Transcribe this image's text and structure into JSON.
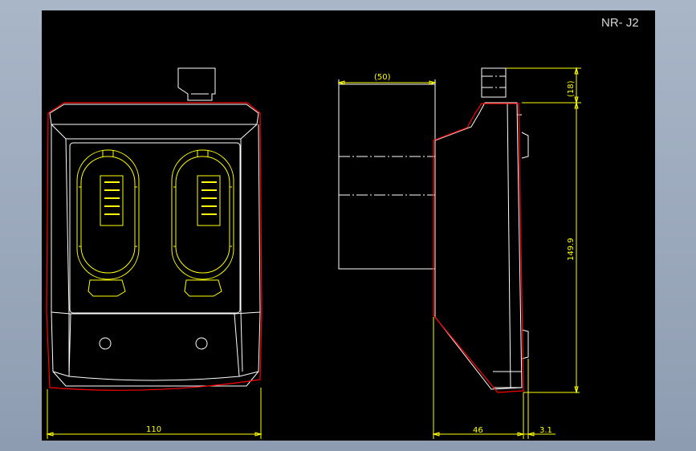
{
  "drawing": {
    "title": "NR- J2",
    "dimensions": {
      "width": "110",
      "depth": "46",
      "thickness": "3.1",
      "height": "149.9",
      "connector": "(18)",
      "cable": "(50)"
    },
    "colors": {
      "background": "#000000",
      "outline": "#ffffff",
      "detail": "#ffff00",
      "housing": "#ff0000",
      "frame": "#9aa8bc"
    }
  }
}
